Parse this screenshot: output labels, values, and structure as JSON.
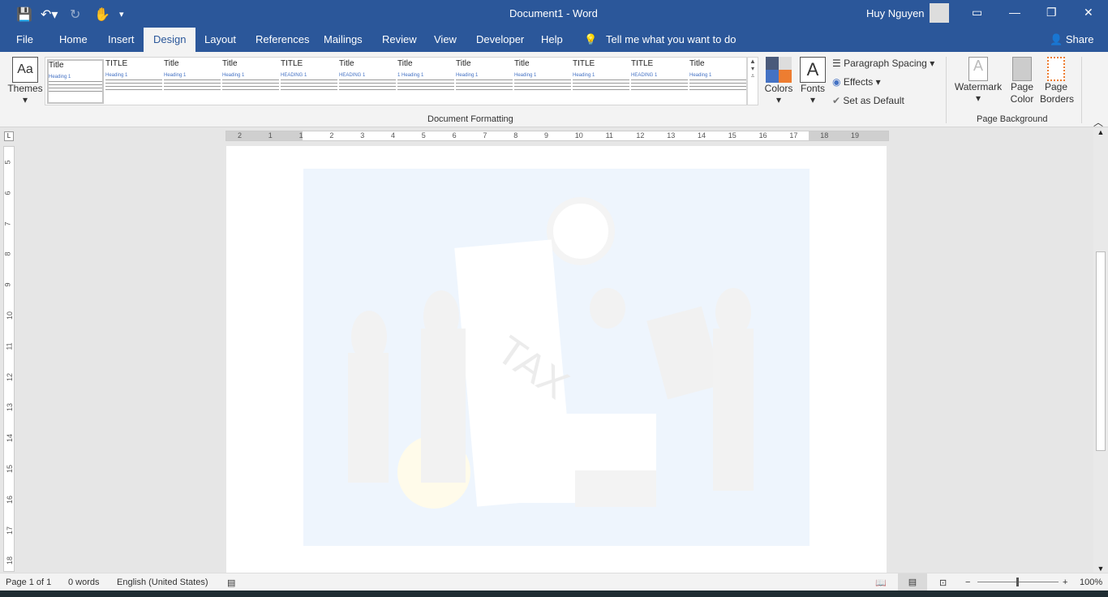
{
  "titlebar": {
    "title": "Document1  -  Word",
    "user": "Huy Nguyen"
  },
  "tabs": [
    "File",
    "Home",
    "Insert",
    "Design",
    "Layout",
    "References",
    "Mailings",
    "Review",
    "View",
    "Developer",
    "Help"
  ],
  "active_tab": "Design",
  "tell_me": "Tell me what you want to do",
  "share": "Share",
  "ribbon": {
    "themes": "Themes",
    "style_gallery": [
      {
        "title": "Title",
        "heading": "Heading 1"
      },
      {
        "title": "TITLE",
        "heading": "Heading 1"
      },
      {
        "title": "Title",
        "heading": "Heading 1"
      },
      {
        "title": "Title",
        "heading": "Heading 1"
      },
      {
        "title": "TITLE",
        "heading": "HEADING 1"
      },
      {
        "title": "Title",
        "heading": "HEADING 1"
      },
      {
        "title": "Title",
        "heading": "1  Heading 1"
      },
      {
        "title": "Title",
        "heading": "Heading 1"
      },
      {
        "title": "Title",
        "heading": "Heading 1"
      },
      {
        "title": "TITLE",
        "heading": "Heading 1"
      },
      {
        "title": "TITLE",
        "heading": "HEADING 1"
      },
      {
        "title": "Title",
        "heading": "Heading 1"
      }
    ],
    "colors": "Colors",
    "fonts": "Fonts",
    "paragraph_spacing": "Paragraph Spacing",
    "effects": "Effects",
    "set_default": "Set as Default",
    "group_document_formatting": "Document Formatting",
    "watermark": "Watermark",
    "page_color": "Page Color",
    "page_borders": "Page Borders",
    "group_page_background": "Page Background"
  },
  "ruler": [
    "2",
    "1",
    "1",
    "2",
    "3",
    "4",
    "5",
    "6",
    "7",
    "8",
    "9",
    "10",
    "11",
    "12",
    "13",
    "14",
    "15",
    "16",
    "17",
    "18",
    "19"
  ],
  "vruler": [
    "5",
    "6",
    "7",
    "8",
    "9",
    "10",
    "11",
    "12",
    "13",
    "14",
    "15",
    "16",
    "17",
    "18"
  ],
  "illustration": {
    "text": "TAX"
  },
  "status": {
    "page": "Page 1 of 1",
    "words": "0 words",
    "language": "English (United States)",
    "zoom": "100%",
    "zoom_level_percent": 100
  },
  "colors": {
    "brand": "#2b579a",
    "accent_orange": "#ed7d31",
    "page_image_bg": "#eef5fd"
  }
}
